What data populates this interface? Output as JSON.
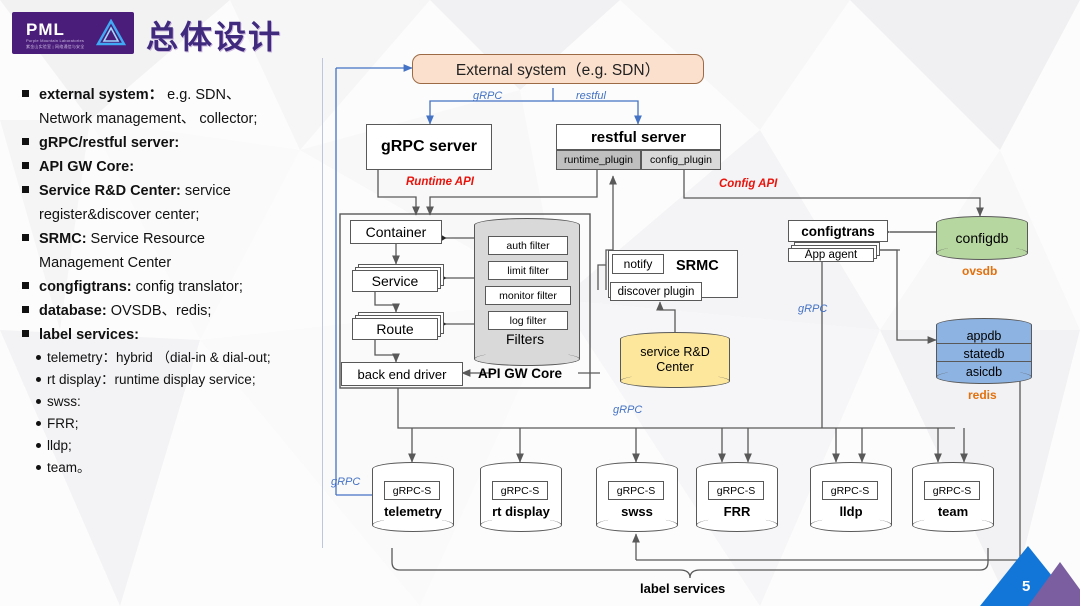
{
  "header": {
    "logo_text": "PML",
    "logo_sub_en": "Purple Mountain Laboratories",
    "logo_sub_cn": "紫金山实验室 | 网络通信与安全",
    "logo_mark_icon": "triangle-logo-icon",
    "title": "总体设计"
  },
  "sidebar": {
    "bullets": [
      {
        "term": "external system：",
        "desc": " e.g. SDN、",
        "cont": "Network management、 collector;"
      },
      {
        "term": "gRPC/restful server:",
        "desc": "",
        "cont": ""
      },
      {
        "term": "API GW Core:",
        "desc": "",
        "cont": ""
      },
      {
        "term": "Service R&D Center:",
        "desc": " service",
        "cont": "register&discover center;"
      },
      {
        "term": "SRMC:",
        "desc": " Service Resource",
        "cont": "Management  Center"
      },
      {
        "term": "congfigtrans:",
        "desc": " config translator;",
        "cont": ""
      },
      {
        "term": "database:",
        "desc": " OVSDB、redis;",
        "cont": ""
      },
      {
        "term": "label services:",
        "desc": "",
        "cont": ""
      }
    ],
    "sub_bullets": [
      "telemetry：hybrid （dial-in & dial-out;",
      "rt display：runtime display service;",
      "swss:",
      "FRR;",
      "lldp;",
      "team。"
    ]
  },
  "diagram": {
    "external_system": "External system（e.g. SDN）",
    "grpc_server": "gRPC server",
    "restful_server": "restful server",
    "runtime_plugin": "runtime_plugin",
    "config_plugin": "config_plugin",
    "edge_grpc_top": "gRPC",
    "edge_restful_top": "restful",
    "runtime_api": "Runtime API",
    "config_api": "Config API",
    "container": "Container",
    "service": "Service",
    "route": "Route",
    "back_end_driver": "back end driver",
    "api_gw_core": "API GW Core",
    "filters_title": "Filters",
    "filters": [
      "auth filter",
      "limit filter",
      "monitor filter",
      "log filter"
    ],
    "notify": "notify",
    "srmc": "SRMC",
    "discover_plugin": "discover plugin",
    "service_rd_center_l1": "service R&D",
    "service_rd_center_l2": "Center",
    "configtrans": "configtrans",
    "app_agent": "App agent",
    "configdb": "configdb",
    "ovsdb": "ovsdb",
    "redis_rows": [
      "appdb",
      "statedb",
      "asicdb"
    ],
    "redis": "redis",
    "grpc_mid_right": "gRPC",
    "grpc_bottom_bus": "gRPC",
    "grpc_left_rail": "gRPC",
    "grpc_s": "gRPC-S",
    "services": [
      "telemetry",
      "rt display",
      "swss",
      "FRR",
      "lldp",
      "team"
    ],
    "label_services": "label services"
  },
  "footer": {
    "page_number": "5"
  },
  "colors": {
    "brand_purple": "#4a1d7a",
    "title_purple": "#3f2a7e",
    "external_fill": "#fbe0cd",
    "configdb_fill": "#b7d7a0",
    "rd_fill": "#fde79c",
    "redis_fill": "#8db3e2",
    "red_label": "#e8140c",
    "blue_label": "#4472c4",
    "orange_label": "#e2700d",
    "accent_blue": "#1276d8"
  }
}
